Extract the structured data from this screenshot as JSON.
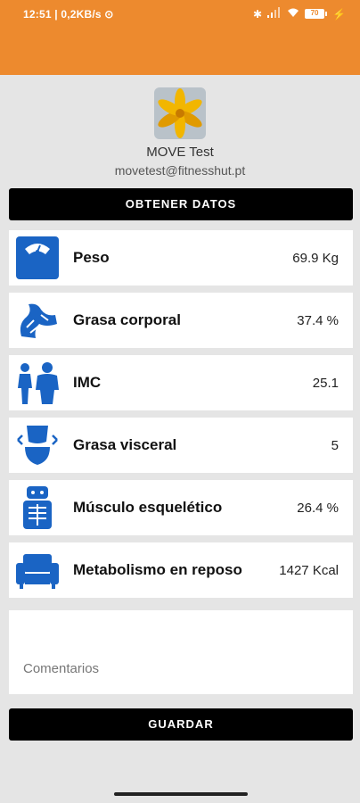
{
  "status_bar": {
    "time_info": "12:51 | 0,2KB/s",
    "battery": "70",
    "colors": {
      "bar": "#ed8a2e"
    }
  },
  "profile": {
    "name": "MOVE Test",
    "email": "movetest@fitnesshut.pt"
  },
  "actions": {
    "obtain_label": "OBTENER DATOS",
    "save_label": "GUARDAR"
  },
  "metrics": [
    {
      "icon": "scale-icon",
      "label": "Peso",
      "value": "69.9 Kg"
    },
    {
      "icon": "body-fat-icon",
      "label": "Grasa corporal",
      "value": "37.4 %"
    },
    {
      "icon": "bmi-people-icon",
      "label": "IMC",
      "value": "25.1"
    },
    {
      "icon": "visceral-fat-icon",
      "label": "Grasa visceral",
      "value": "5"
    },
    {
      "icon": "skeletal-muscle-icon",
      "label": "Músculo esquelético",
      "value": "26.4 %"
    },
    {
      "icon": "sofa-icon",
      "label": "Metabolismo en reposo",
      "value": "1427 Kcal"
    }
  ],
  "comments": {
    "placeholder": "Comentarios",
    "value": ""
  },
  "theme": {
    "icon_blue": "#1a64c4",
    "button_black": "#000000"
  }
}
